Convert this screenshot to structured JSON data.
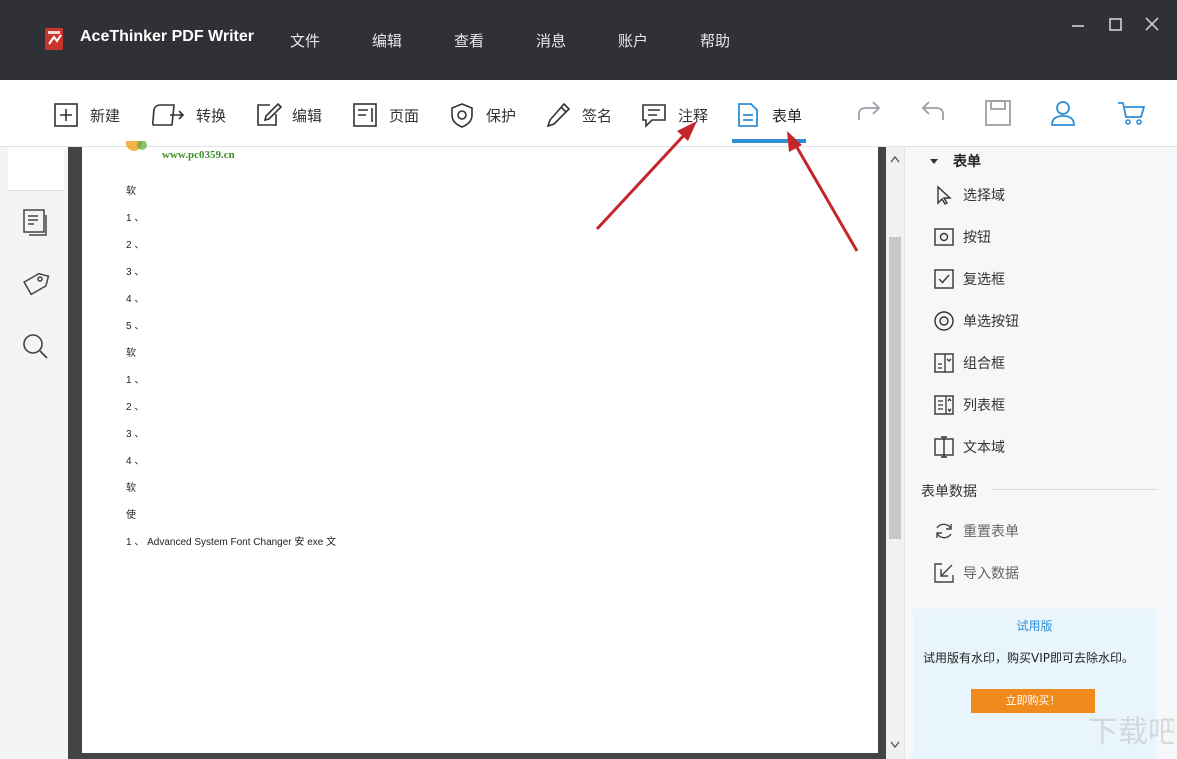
{
  "app": {
    "title": "AceThinker PDF Writer"
  },
  "menu": [
    "文件",
    "编辑",
    "查看",
    "消息",
    "账户",
    "帮助"
  ],
  "toolbar": {
    "tools": [
      {
        "label": "新建",
        "icon": "new-icon"
      },
      {
        "label": "转换",
        "icon": "convert-icon"
      },
      {
        "label": "编辑",
        "icon": "edit-icon"
      },
      {
        "label": "页面",
        "icon": "page-icon"
      },
      {
        "label": "保护",
        "icon": "shield-icon"
      },
      {
        "label": "签名",
        "icon": "pen-icon"
      },
      {
        "label": "注释",
        "icon": "comment-icon"
      },
      {
        "label": "表单",
        "icon": "form-icon"
      }
    ],
    "active_tab": "表单",
    "accent_color": "#2e8ed6"
  },
  "document": {
    "watermark": "www.pc0359.cn",
    "lines": [
      "软",
      "1 、",
      "2 、",
      "3 、",
      "4 、",
      "5 、",
      "软",
      "1 、",
      "2 、",
      "3 、",
      "4 、",
      "软",
      "使",
      "1 、 Advanced System Font Changer 安 exe 文"
    ]
  },
  "right_panel": {
    "header": "表单",
    "items": [
      {
        "label": "选择域",
        "icon": "cursor-icon"
      },
      {
        "label": "按钮",
        "icon": "button-icon"
      },
      {
        "label": "复选框",
        "icon": "checkbox-icon"
      },
      {
        "label": "单选按钮",
        "icon": "radio-icon"
      },
      {
        "label": "组合框",
        "icon": "combobox-icon"
      },
      {
        "label": "列表框",
        "icon": "listbox-icon"
      },
      {
        "label": "文本域",
        "icon": "textfield-icon"
      }
    ],
    "section_title": "表单数据",
    "data_items": [
      {
        "label": "重置表单",
        "icon": "reset-icon"
      },
      {
        "label": "导入数据",
        "icon": "import-icon"
      }
    ]
  },
  "trial": {
    "title": "试用版",
    "text": "试用版有水印，购买VIP即可去除水印。",
    "buy_label": "立即购买！",
    "button_color": "#f08a1c"
  }
}
